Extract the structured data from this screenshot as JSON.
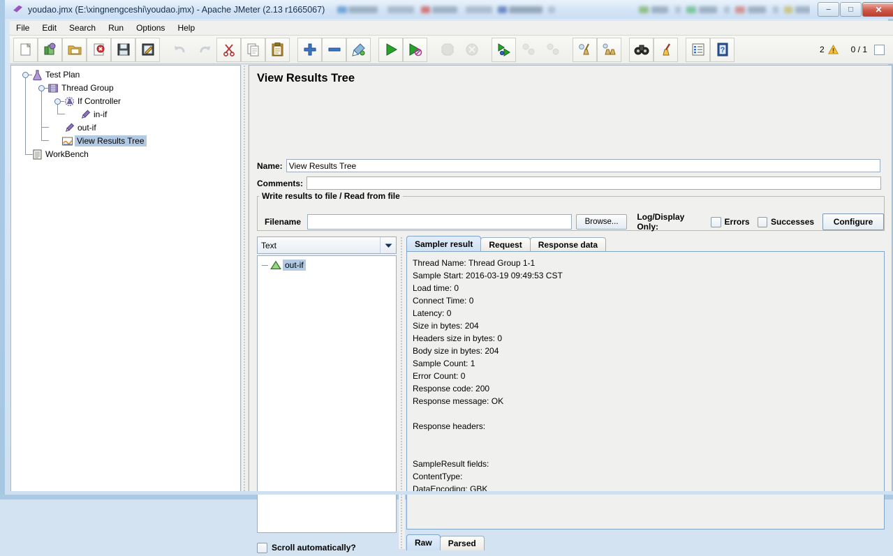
{
  "window": {
    "title": "youdao.jmx (E:\\xingnengceshi\\youdao.jmx) - Apache JMeter (2.13 r1665067)",
    "app_icon": "jmeter-feather-icon",
    "minimize": "–",
    "maximize": "□",
    "close": "✕"
  },
  "menubar": {
    "items": [
      "File",
      "Edit",
      "Search",
      "Run",
      "Options",
      "Help"
    ]
  },
  "toolbar": {
    "buttons": [
      {
        "name": "new-button",
        "icon": "new-document-icon"
      },
      {
        "name": "templates-button",
        "icon": "templates-icon"
      },
      {
        "name": "open-button",
        "icon": "open-folder-icon"
      },
      {
        "name": "close-button",
        "icon": "close-document-icon"
      },
      {
        "name": "save-button",
        "icon": "save-floppy-icon"
      },
      {
        "name": "save-as-button",
        "icon": "save-as-icon"
      },
      {
        "name": "undo-button",
        "icon": "undo-arrow-icon",
        "disabled": true
      },
      {
        "name": "redo-button",
        "icon": "redo-arrow-icon",
        "disabled": true
      },
      {
        "name": "cut-button",
        "icon": "scissors-icon"
      },
      {
        "name": "copy-button",
        "icon": "copy-pages-icon"
      },
      {
        "name": "paste-button",
        "icon": "clipboard-icon"
      },
      {
        "name": "expand-all-button",
        "icon": "plus-icon"
      },
      {
        "name": "collapse-all-button",
        "icon": "minus-icon"
      },
      {
        "name": "toggle-button",
        "icon": "toggle-pencil-icon"
      },
      {
        "name": "start-button",
        "icon": "green-play-icon"
      },
      {
        "name": "start-no-pauses-button",
        "icon": "green-play-no-pause-icon"
      },
      {
        "name": "stop-button",
        "icon": "stop-octagon-icon",
        "disabled": true
      },
      {
        "name": "shutdown-button",
        "icon": "shutdown-circle-icon",
        "disabled": true
      },
      {
        "name": "remote-start-all-button",
        "icon": "remote-start-icon"
      },
      {
        "name": "remote-stop-all-button",
        "icon": "remote-stop-icon",
        "disabled": true
      },
      {
        "name": "remote-shutdown-all-button",
        "icon": "remote-shutdown-icon",
        "disabled": true
      },
      {
        "name": "clear-button",
        "icon": "broom-clear-icon"
      },
      {
        "name": "clear-all-button",
        "icon": "broom-clear-all-icon"
      },
      {
        "name": "search-button",
        "icon": "binoculars-icon"
      },
      {
        "name": "reset-search-button",
        "icon": "reset-search-broom-icon"
      },
      {
        "name": "function-helper-button",
        "icon": "function-helper-list-icon"
      },
      {
        "name": "help-button",
        "icon": "help-book-icon"
      }
    ],
    "warning_count": "2",
    "warning_icon": "warning-triangle-icon",
    "thread_counter": "0 / 1"
  },
  "tree": {
    "nodes": [
      {
        "label": "Test Plan",
        "icon": "test-plan-icon",
        "depth": 0,
        "selected": false
      },
      {
        "label": "Thread Group",
        "icon": "thread-group-icon",
        "depth": 1,
        "selected": false
      },
      {
        "label": "If Controller",
        "icon": "if-controller-icon",
        "depth": 2,
        "selected": false
      },
      {
        "label": "in-if",
        "icon": "sampler-icon",
        "depth": 3,
        "selected": false
      },
      {
        "label": "out-if",
        "icon": "sampler-icon",
        "depth": 2,
        "selected": false
      },
      {
        "label": "View Results Tree",
        "icon": "view-results-tree-icon",
        "depth": 2,
        "selected": true
      },
      {
        "label": "WorkBench",
        "icon": "workbench-icon",
        "depth": 0,
        "selected": false
      }
    ]
  },
  "panel": {
    "title": "View Results Tree",
    "name_label": "Name:",
    "name_value": "View Results Tree",
    "comments_label": "Comments:",
    "comments_value": "",
    "group_legend": "Write results to file / Read from file",
    "filename_label": "Filename",
    "filename_value": "",
    "browse_label": "Browse...",
    "log_display_label": "Log/Display Only:",
    "errors_label": "Errors",
    "errors_checked": false,
    "successes_label": "Successes",
    "successes_checked": false,
    "configure_label": "Configure"
  },
  "results": {
    "render_combo_value": "Text",
    "render_combo_icon": "chevron-down-icon",
    "items": [
      {
        "label": "out-if",
        "icon": "success-triangle-icon",
        "selected": true
      }
    ],
    "scroll_auto_label": "Scroll automatically?",
    "scroll_auto_checked": false
  },
  "tabs": {
    "items": [
      {
        "label": "Sampler result",
        "active": true
      },
      {
        "label": "Request",
        "active": false
      },
      {
        "label": "Response data",
        "active": false
      }
    ],
    "sampler_result_text": "Thread Name: Thread Group 1-1\nSample Start: 2016-03-19 09:49:53 CST\nLoad time: 0\nConnect Time: 0\nLatency: 0\nSize in bytes: 204\nHeaders size in bytes: 0\nBody size in bytes: 204\nSample Count: 1\nError Count: 0\nResponse code: 200\nResponse message: OK\n\nResponse headers:\n\n\nSampleResult fields:\nContentType:\nDataEncoding: GBK"
  },
  "bottom_tabs": {
    "items": [
      {
        "label": "Raw",
        "active": true
      },
      {
        "label": "Parsed",
        "active": false
      }
    ]
  },
  "colors": {
    "selection": "#b3cae5",
    "tab_active": "#cfe0f3",
    "window_chrome": "#cfe0f1",
    "panel_bg": "#f0f0ee",
    "warning": "#f5c242",
    "success_green": "#4a9b3f",
    "close_red": "#cf5a4a"
  }
}
